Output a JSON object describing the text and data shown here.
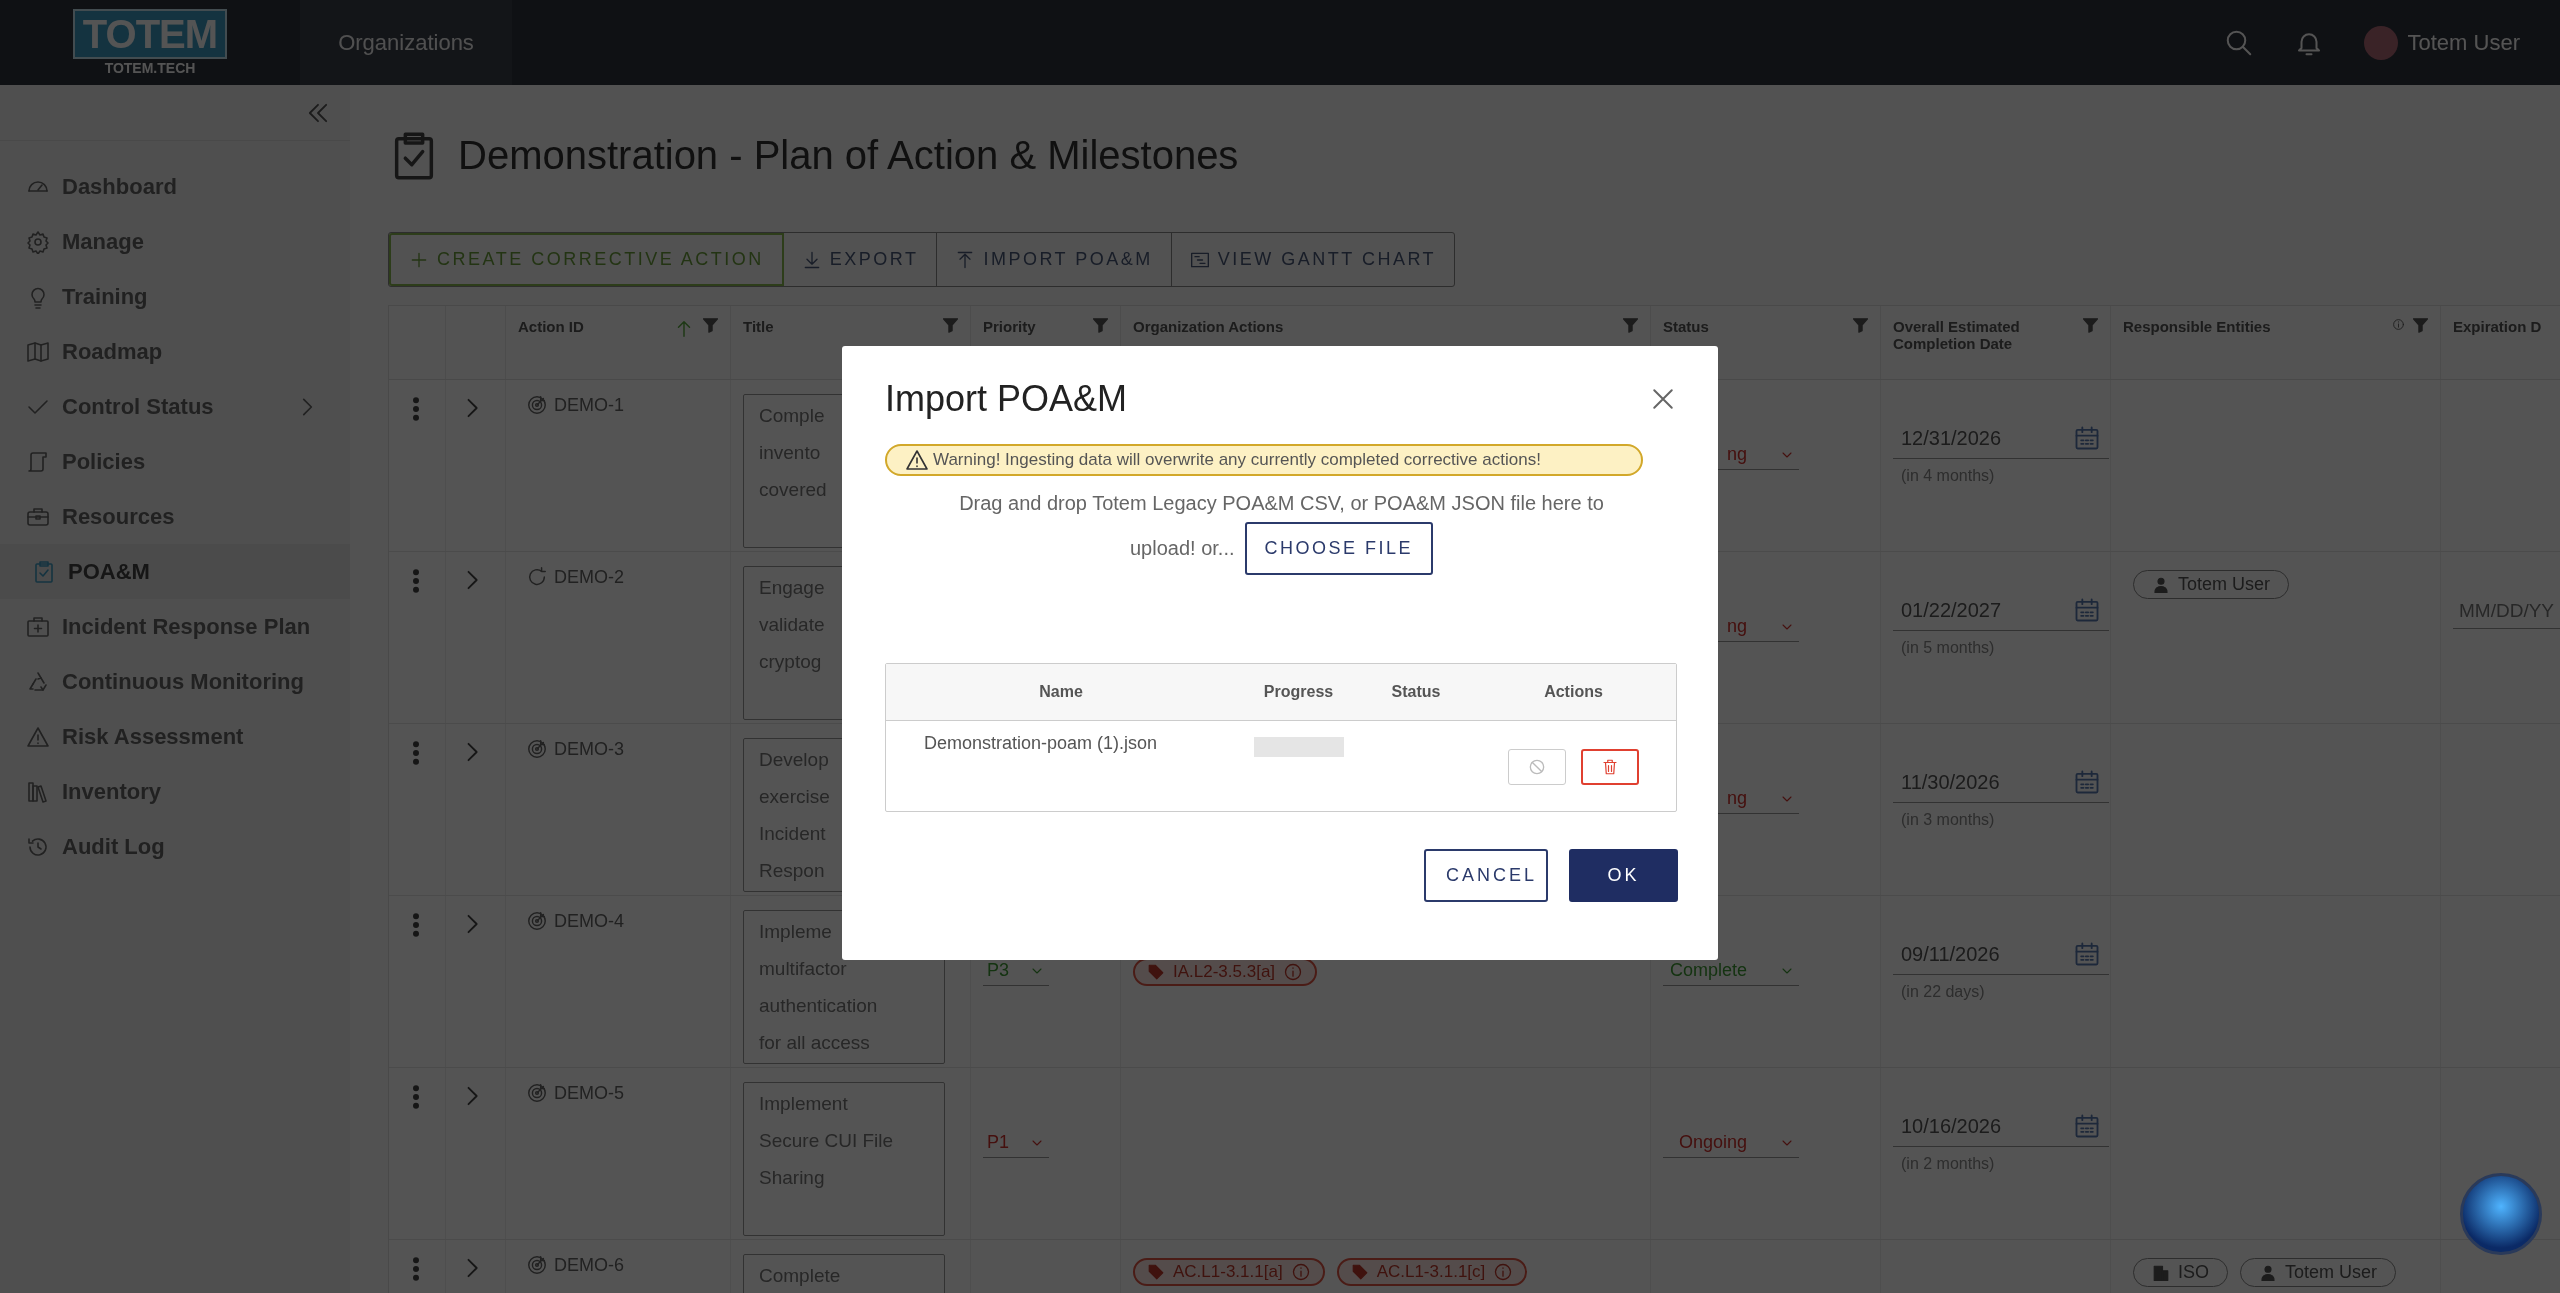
{
  "topbar": {
    "logo": "TOTEM",
    "logo_sub": "TOTEM.TECH",
    "nav": "Organizations",
    "user": "Totem User"
  },
  "sidebar": {
    "items": [
      {
        "label": "Dashboard",
        "selected": false,
        "submenu": false
      },
      {
        "label": "Manage",
        "selected": false,
        "submenu": false
      },
      {
        "label": "Training",
        "selected": false,
        "submenu": false
      },
      {
        "label": "Roadmap",
        "selected": false,
        "submenu": false
      },
      {
        "label": "Control Status",
        "selected": false,
        "submenu": true
      },
      {
        "label": "Policies",
        "selected": false,
        "submenu": false
      },
      {
        "label": "Resources",
        "selected": false,
        "submenu": false
      },
      {
        "label": "POA&M",
        "selected": true,
        "submenu": false
      },
      {
        "label": "Incident Response Plan",
        "selected": false,
        "submenu": false
      },
      {
        "label": "Continuous Monitoring",
        "selected": false,
        "submenu": false
      },
      {
        "label": "Risk Assessment",
        "selected": false,
        "submenu": false
      },
      {
        "label": "Inventory",
        "selected": false,
        "submenu": false
      },
      {
        "label": "Audit Log",
        "selected": false,
        "submenu": false
      }
    ]
  },
  "page": {
    "title": "Demonstration - Plan of Action & Milestones"
  },
  "toolbar": [
    {
      "label": "CREATE CORRECTIVE ACTION",
      "kind": "primary"
    },
    {
      "label": "EXPORT",
      "kind": "plain"
    },
    {
      "label": "IMPORT POA&M",
      "kind": "plain"
    },
    {
      "label": "VIEW GANTT CHART",
      "kind": "plain"
    }
  ],
  "table": {
    "columns": [
      {
        "filter": false,
        "sorted": false,
        "info": false
      },
      {
        "filter": false,
        "sorted": false,
        "info": false
      },
      {
        "label": "Action ID",
        "filter": true,
        "sorted": true,
        "info": false
      },
      {
        "label": "Title",
        "filter": true,
        "sorted": false,
        "info": false
      },
      {
        "label": "Priority",
        "filter": true,
        "sorted": false,
        "info": false
      },
      {
        "label": "Organization Actions",
        "filter": true,
        "sorted": false,
        "info": false
      },
      {
        "label": "Status",
        "filter": true,
        "sorted": false,
        "info": false
      },
      {
        "label": "Overall Estimated Completion Date",
        "filter": true,
        "sorted": false,
        "info": false
      },
      {
        "label": "Responsible Entities",
        "filter": true,
        "sorted": false,
        "info": true
      },
      {
        "label": "Expiration D"
      }
    ],
    "rows": [
      {
        "id": "DEMO-1",
        "kind": "target",
        "title_lines": [
          "Comple",
          "invento",
          "covered"
        ],
        "status": {
          "text": "ng",
          "kind": "open"
        },
        "date": "12/31/2026",
        "relative": "(in 4 months)",
        "tags": [],
        "responsible": []
      },
      {
        "id": "DEMO-2",
        "kind": "refresh",
        "title_lines": [
          "Engage",
          "validate",
          "cryptog"
        ],
        "status": {
          "text": "ng",
          "kind": "open"
        },
        "date": "01/22/2027",
        "relative": "(in 5 months)",
        "tags": [],
        "responsible": [
          {
            "label": "Totem User",
            "kind": "person"
          }
        ],
        "expiration_placeholder": "MM/DD/YY"
      },
      {
        "id": "DEMO-3",
        "kind": "target",
        "title_lines": [
          "Develop",
          "exercise",
          "Incident",
          "Respon"
        ],
        "status": {
          "text": "ng",
          "kind": "open"
        },
        "date": "11/30/2026",
        "relative": "(in 3 months)",
        "tags": [],
        "responsible": []
      },
      {
        "id": "DEMO-4",
        "kind": "target",
        "title_lines": [
          "Impleme",
          "multifactor",
          "authentication",
          "for all access"
        ],
        "priority": {
          "text": "P3",
          "kind": "low"
        },
        "status": {
          "text": "Complete",
          "kind": "done"
        },
        "date": "09/11/2026",
        "relative": "(in 22 days)",
        "tags": [
          "IA.L2-3.5.3[a]"
        ],
        "responsible": []
      },
      {
        "id": "DEMO-5",
        "kind": "target",
        "title_lines": [
          "Implement",
          "Secure CUI File",
          "Sharing"
        ],
        "priority": {
          "text": "P1",
          "kind": "high"
        },
        "status": {
          "text": "Ongoing",
          "kind": "open"
        },
        "date": "10/16/2026",
        "relative": "(in 2 months)",
        "tags": [],
        "responsible": []
      },
      {
        "id": "DEMO-6",
        "kind": "target",
        "title_lines": [
          "Complete"
        ],
        "tags": [
          "AC.L1-3.1.1[a]",
          "AC.L1-3.1.1[c]"
        ],
        "responsible": [
          {
            "label": "ISO",
            "kind": "building"
          },
          {
            "label": "Totem User",
            "kind": "person"
          }
        ]
      }
    ]
  },
  "modal": {
    "title": "Import POA&M",
    "warning": "Warning! Ingesting data will overwrite any currently completed corrective actions!",
    "instructions": "Drag and drop Totem Legacy POA&M CSV, or POA&M JSON file here to",
    "instructions_end": "upload! or...",
    "choose_button": "CHOOSE FILE",
    "upload_table": {
      "columns": [
        "Name",
        "Progress",
        "Status",
        "Actions"
      ],
      "rows": [
        {
          "name": "Demonstration-poam (1).json",
          "level": 0,
          "cancel_disabled": true
        }
      ]
    },
    "buttons": [
      {
        "label": "CANCEL",
        "kind": "secondary"
      },
      {
        "label": "OK",
        "kind": "primary"
      }
    ]
  }
}
